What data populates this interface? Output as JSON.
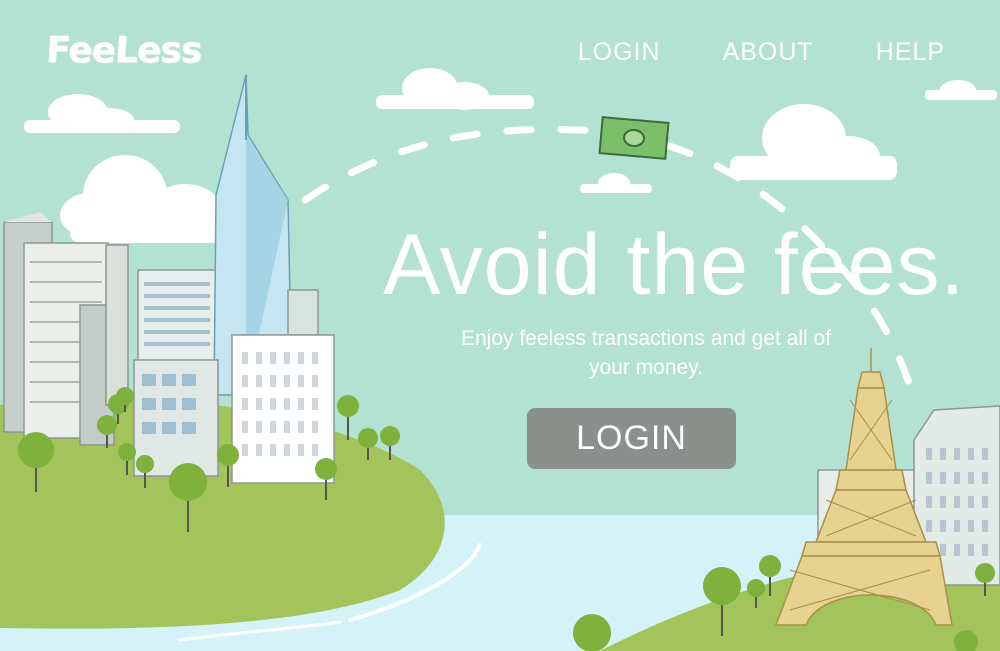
{
  "brand": {
    "logo_text": "FeeLess"
  },
  "nav": {
    "items": [
      {
        "label": "LOGIN"
      },
      {
        "label": "ABOUT"
      },
      {
        "label": "HELP"
      }
    ]
  },
  "hero": {
    "title": "Avoid the fees.",
    "subtitle": "Enjoy feeless transactions and get all of your money.",
    "cta_label": "LOGIN"
  },
  "colors": {
    "sky": "#b4e2d2",
    "grass": "#a2c45a",
    "water": "#d4f3f8",
    "button": "#8b908d",
    "money": "#7cbf6b",
    "eiffel": "#e7d38f"
  },
  "icons": [
    "cloud-icon",
    "money-bill-icon",
    "tree-icon",
    "eiffel-tower-icon",
    "skyscraper-icon"
  ]
}
